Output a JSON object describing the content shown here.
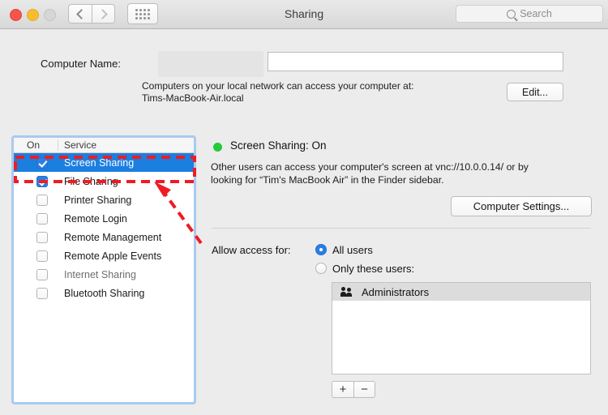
{
  "window": {
    "title": "Sharing",
    "traffic_lights": [
      "close",
      "minimize",
      "zoom"
    ],
    "nav_back_icon": "chevron-left-icon",
    "nav_forward_icon": "chevron-right-icon",
    "grid_icon": "grid-dots-icon"
  },
  "search": {
    "placeholder": "Search",
    "icon": "search-icon",
    "value": ""
  },
  "computer_name": {
    "label": "Computer Name:",
    "value": "",
    "redacted": true,
    "help_line1": "Computers on your local network can access your computer at:",
    "help_line2": "Tims-MacBook-Air.local",
    "edit_label": "Edit..."
  },
  "service_list": {
    "header_on": "On",
    "header_service": "Service",
    "items": [
      {
        "label": "Screen Sharing",
        "checked": true,
        "selected": true,
        "enabled": true
      },
      {
        "label": "File Sharing",
        "checked": true,
        "selected": false,
        "enabled": true
      },
      {
        "label": "Printer Sharing",
        "checked": false,
        "selected": false,
        "enabled": true
      },
      {
        "label": "Remote Login",
        "checked": false,
        "selected": false,
        "enabled": true
      },
      {
        "label": "Remote Management",
        "checked": false,
        "selected": false,
        "enabled": true
      },
      {
        "label": "Remote Apple Events",
        "checked": false,
        "selected": false,
        "enabled": true
      },
      {
        "label": "Internet Sharing",
        "checked": false,
        "selected": false,
        "enabled": false
      },
      {
        "label": "Bluetooth Sharing",
        "checked": false,
        "selected": false,
        "enabled": true
      }
    ]
  },
  "detail": {
    "status_title": "Screen Sharing: On",
    "status_color": "#27ca38",
    "description_line1": "Other users can access your computer's screen at vnc://10.0.0.14/ or by",
    "description_line2": "looking for “Tim's MacBook Air” in the Finder sidebar.",
    "computer_settings_label": "Computer Settings..."
  },
  "access": {
    "label": "Allow access for:",
    "options": [
      {
        "label": "All users",
        "selected": true
      },
      {
        "label": "Only these users:",
        "selected": false
      }
    ],
    "users": [
      {
        "name": "Administrators",
        "icon": "people-group-icon"
      }
    ],
    "add_label": "+",
    "remove_label": "−"
  },
  "annotation": {
    "color": "#ee1c25",
    "highlight_target": "Screen Sharing",
    "arrow": "dashed-arrow-pointing-to-screen-sharing-row"
  },
  "colors": {
    "selection_blue": "#1b7fe0",
    "focus_ring": "#a8cbee",
    "window_bg": "#ececec",
    "annotation_red": "#ee1c25"
  }
}
